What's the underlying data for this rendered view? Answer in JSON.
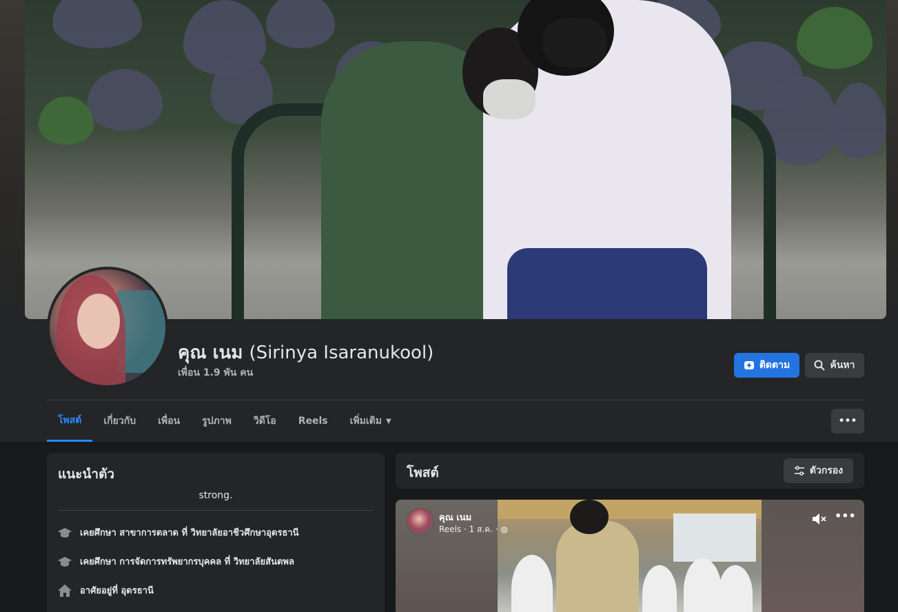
{
  "profile": {
    "name": "คุณ เนม",
    "alt_name": "(Sirinya Isaranukool)",
    "friends": "เพื่อน 1.9 พัน คน"
  },
  "actions": {
    "follow_label": "ติดตาม",
    "search_label": "ค้นหา",
    "more_label": "•••"
  },
  "tabs": [
    {
      "label": "โพสต์"
    },
    {
      "label": "เกี่ยวกับ"
    },
    {
      "label": "เพื่อน"
    },
    {
      "label": "รูปภาพ"
    },
    {
      "label": "วิดีโอ"
    },
    {
      "label": "Reels"
    },
    {
      "label": "เพิ่มเติม"
    }
  ],
  "intro": {
    "title": "แนะนำตัว",
    "bio": "strong.",
    "items": [
      {
        "icon": "graduation-cap-icon",
        "text": "เคยศึกษา สาขาการตลาด ที่ วิทยาลัยอาชีวศึกษาอุดรธานี"
      },
      {
        "icon": "graduation-cap-icon",
        "text": "เคยศึกษา การจัดการทรัพยากรบุคคล ที่ วิทยาลัยสันตพล"
      },
      {
        "icon": "home-icon",
        "text": "อาศัยอยู่ที่ อุดรธานี"
      }
    ]
  },
  "posts": {
    "title": "โพสต์",
    "filter_label": "ตัวกรอง",
    "reel": {
      "author": "คุณ เนม",
      "meta": "Reels · 1 ส.ค. ·"
    }
  },
  "colors": {
    "accent": "#2374e1",
    "active_tab": "#2d88ff",
    "card_bg": "#242526",
    "page_bg": "#18191a"
  }
}
